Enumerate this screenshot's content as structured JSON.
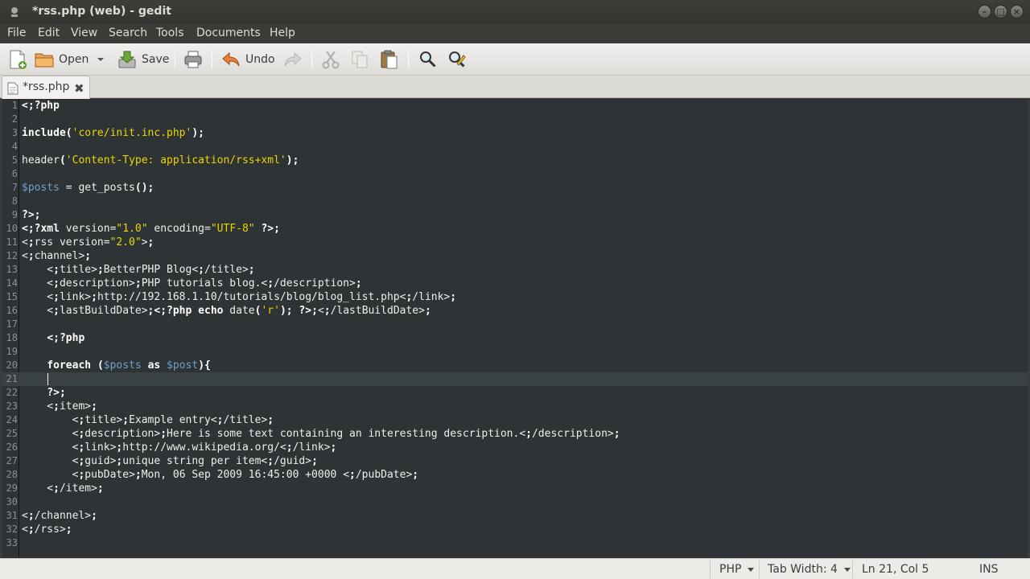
{
  "window": {
    "title": "*rss.php (web) - gedit"
  },
  "menubar": {
    "items": [
      "File",
      "Edit",
      "View",
      "Search",
      "Tools",
      "Documents",
      "Help"
    ]
  },
  "toolbar": {
    "open_label": "Open",
    "save_label": "Save",
    "undo_label": "Undo"
  },
  "tab": {
    "label": "*rss.php"
  },
  "editor": {
    "current_line": 21,
    "lines": [
      "<?php",
      "",
      "include('core/init.inc.php');",
      "",
      "header('Content-Type: application/rss+xml');",
      "",
      "$posts = get_posts();",
      "",
      "?>",
      "<?xml version=\"1.0\" encoding=\"UTF-8\" ?>",
      "<rss version=\"2.0\">",
      "<channel>",
      "    <title>BetterPHP Blog</title>",
      "    <description>PHP tutorials blog.</description>",
      "    <link>http://192.168.1.10/tutorials/blog/blog_list.php</link>",
      "    <lastBuildDate><?php echo date('r'); ?></lastBuildDate>",
      "",
      "    <?php",
      "",
      "    foreach ($posts as $post){",
      "",
      "    ?>",
      "    <item>",
      "        <title>Example entry</title>",
      "        <description>Here is some text containing an interesting description.</description>",
      "        <link>http://www.wikipedia.org/</link>",
      "        <guid>unique string per item</guid>",
      "        <pubDate>Mon, 06 Sep 2009 16:45:00 +0000 </pubDate>",
      "    </item>",
      "",
      "</channel>",
      "</rss>",
      ""
    ]
  },
  "statusbar": {
    "language": "PHP",
    "tab_width": "Tab Width: 4",
    "position": "Ln 21, Col 5",
    "mode": "INS"
  },
  "colors": {
    "editor_bg": "#2e3436",
    "keyword": "#ffffff",
    "string": "#edd400",
    "variable": "#729fcf",
    "tag": "#729fcf"
  }
}
